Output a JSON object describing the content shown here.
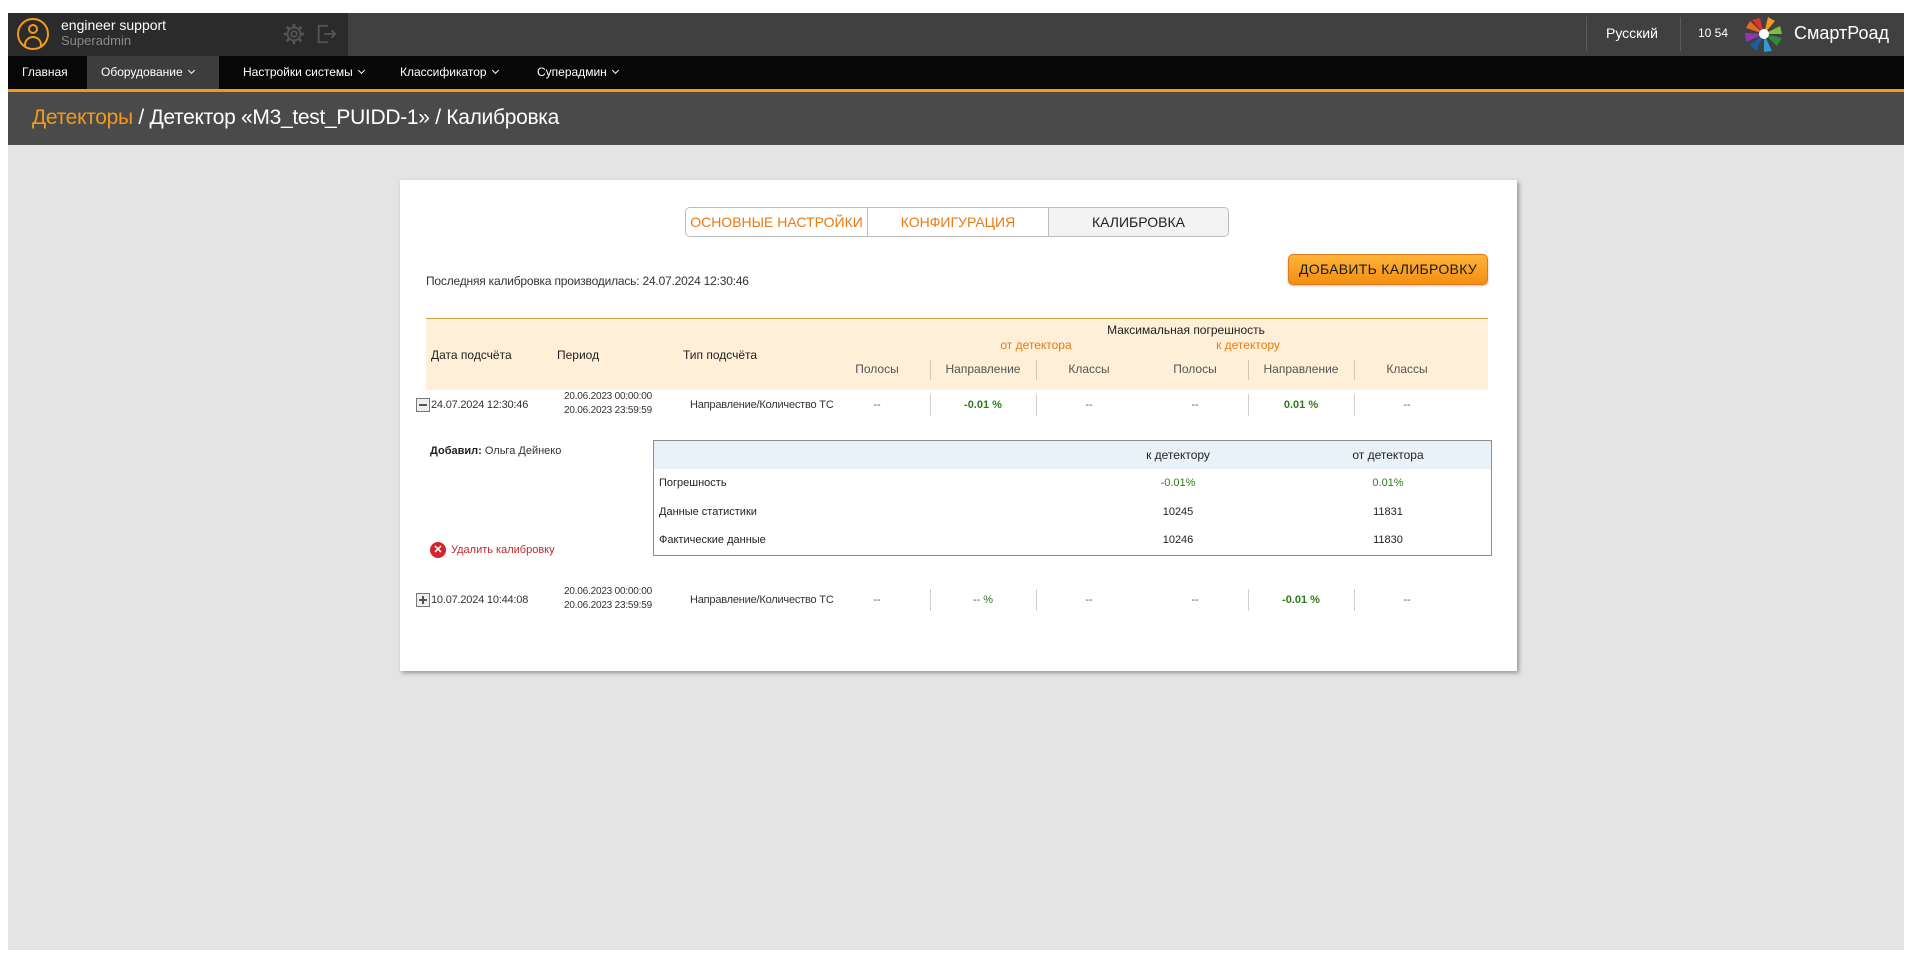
{
  "user": {
    "name": "engineer support",
    "role": "Superadmin"
  },
  "topbar": {
    "language": "Русский",
    "time": "10 54",
    "brand": "СмартРоад"
  },
  "nav": [
    {
      "label": "Главная"
    },
    {
      "label": "Оборудование"
    },
    {
      "label": "Настройки системы"
    },
    {
      "label": "Классификатор"
    },
    {
      "label": "Суперадмин"
    }
  ],
  "breadcrumb": {
    "root": "Детекторы",
    "sep1": " / ",
    "detector": "Детектор «M3_test_PUIDD-1»",
    "sep2": " / ",
    "current": "Калибровка"
  },
  "tabs": [
    {
      "label": "ОСНОВНЫЕ НАСТРОЙКИ"
    },
    {
      "label": "КОНФИГУРАЦИЯ"
    },
    {
      "label": "КАЛИБРОВКА"
    }
  ],
  "last_calibration": "Последняя калибровка производилась: 24.07.2024 12:30:46",
  "add_button": "ДОБАВИТЬ КАЛИБРОВКУ",
  "table": {
    "col_date": "Дата подсчёта",
    "col_period": "Период",
    "col_type": "Тип подсчёта",
    "max_error": "Максимальная погрешность",
    "from_detector": "от детектора",
    "to_detector": "к детектору",
    "sub": [
      "Полосы",
      "Направление",
      "Классы",
      "Полосы",
      "Направление",
      "Классы"
    ]
  },
  "rows": [
    {
      "date": "24.07.2024 12:30:46",
      "period_start": "20.06.2023 00:00:00",
      "period_end": "20.06.2023 23:59:59",
      "type": "Направление/Количество ТС",
      "values": [
        "--",
        "-0.01 %",
        "--",
        "--",
        "0.01 %",
        "--"
      ]
    },
    {
      "date": "10.07.2024 10:44:08",
      "period_start": "20.06.2023 00:00:00",
      "period_end": "20.06.2023 23:59:59",
      "type": "Направление/Количество ТС",
      "values": [
        "--",
        "-- %",
        "--",
        "--",
        "-0.01 %",
        "--"
      ]
    }
  ],
  "detail": {
    "added_by_label": "Добавил:",
    "added_by_name": "Ольга Дейнеко",
    "delete_label": "Удалить калибровку",
    "head_to": "к детектору",
    "head_from": "от детектора",
    "rows": [
      {
        "label": "Погрешность",
        "to": "-0.01%",
        "from": "0.01%"
      },
      {
        "label": "Данные статистики",
        "to": "10245",
        "from": "11831"
      },
      {
        "label": "Фактические данные",
        "to": "10246",
        "from": "11830"
      }
    ]
  },
  "colors": {
    "accent": "#f39a1e",
    "value_green": "#2e7d1a",
    "danger": "#d0252b"
  }
}
